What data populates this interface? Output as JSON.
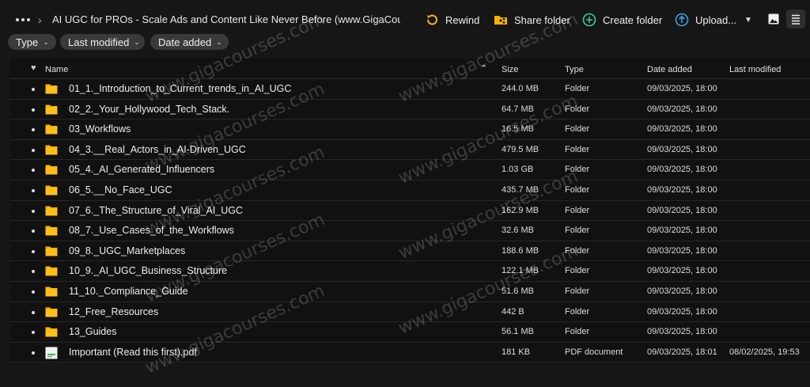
{
  "header": {
    "title": "AI UGC for PROs - Scale Ads and Content Like Never Before (www.GigaCourses....",
    "actions": {
      "rewind": "Rewind",
      "share_folder": "Share folder",
      "create_folder": "Create folder",
      "upload": "Upload..."
    },
    "icons": [
      "more-icon",
      "chevron-right-icon",
      "rewind-icon",
      "share-folder-icon",
      "create-folder-icon",
      "upload-icon",
      "image-view-icon",
      "list-view-icon"
    ]
  },
  "filters": {
    "type": "Type",
    "last_modified": "Last modified",
    "date_added": "Date added"
  },
  "table": {
    "columns": {
      "name": "Name",
      "size": "Size",
      "type": "Type",
      "date_added": "Date added",
      "last_modified": "Last modified"
    },
    "rows": [
      {
        "name": "01_1._Introduction_to_Current_trends_in_AI_UGC",
        "size": "244.0 MB",
        "type": "Folder",
        "date_added": "09/03/2025, 18:00",
        "last_modified": "",
        "icon": "folder-icon"
      },
      {
        "name": "02_2._Your_Hollywood_Tech_Stack.",
        "size": "64.7 MB",
        "type": "Folder",
        "date_added": "09/03/2025, 18:00",
        "last_modified": "",
        "icon": "folder-icon"
      },
      {
        "name": "03_Workflows",
        "size": "16.5 MB",
        "type": "Folder",
        "date_added": "09/03/2025, 18:00",
        "last_modified": "",
        "icon": "folder-icon"
      },
      {
        "name": "04_3.__Real_Actors_in_AI-Driven_UGC",
        "size": "479.5 MB",
        "type": "Folder",
        "date_added": "09/03/2025, 18:00",
        "last_modified": "",
        "icon": "folder-icon"
      },
      {
        "name": "05_4._AI_Generated_Influencers",
        "size": "1.03 GB",
        "type": "Folder",
        "date_added": "09/03/2025, 18:00",
        "last_modified": "",
        "icon": "folder-icon"
      },
      {
        "name": "06_5.__No_Face_UGC",
        "size": "435.7 MB",
        "type": "Folder",
        "date_added": "09/03/2025, 18:00",
        "last_modified": "",
        "icon": "folder-icon"
      },
      {
        "name": "07_6._The_Structure_of_Viral_AI_UGC",
        "size": "162.9 MB",
        "type": "Folder",
        "date_added": "09/03/2025, 18:00",
        "last_modified": "",
        "icon": "folder-icon"
      },
      {
        "name": "08_7._Use_Cases_of_the_Workflows",
        "size": "32.6 MB",
        "type": "Folder",
        "date_added": "09/03/2025, 18:00",
        "last_modified": "",
        "icon": "folder-icon"
      },
      {
        "name": "09_8._UGC_Marketplaces",
        "size": "188.6 MB",
        "type": "Folder",
        "date_added": "09/03/2025, 18:00",
        "last_modified": "",
        "icon": "folder-icon"
      },
      {
        "name": "10_9._AI_UGC_Business_Structure",
        "size": "122.1 MB",
        "type": "Folder",
        "date_added": "09/03/2025, 18:00",
        "last_modified": "",
        "icon": "folder-icon"
      },
      {
        "name": "11_10._Compliance_Guide",
        "size": "51.6 MB",
        "type": "Folder",
        "date_added": "09/03/2025, 18:00",
        "last_modified": "",
        "icon": "folder-icon"
      },
      {
        "name": "12_Free_Resources",
        "size": "442 B",
        "type": "Folder",
        "date_added": "09/03/2025, 18:00",
        "last_modified": "",
        "icon": "folder-icon"
      },
      {
        "name": "13_Guides",
        "size": "56.1 MB",
        "type": "Folder",
        "date_added": "09/03/2025, 18:00",
        "last_modified": "",
        "icon": "folder-icon"
      },
      {
        "name": "Important (Read this first).pdf",
        "size": "181 KB",
        "type": "PDF document",
        "date_added": "09/03/2025, 18:01",
        "last_modified": "08/02/2025, 19:53",
        "icon": "pdf-file-icon"
      }
    ]
  },
  "watermark": "www.gigacourses.com",
  "colors": {
    "background": "#161616",
    "table_background": "#111111",
    "folder": "#f5b400",
    "rewind": "#f2b623",
    "create_folder": "#3ec9a0",
    "upload": "#39a3e6"
  }
}
